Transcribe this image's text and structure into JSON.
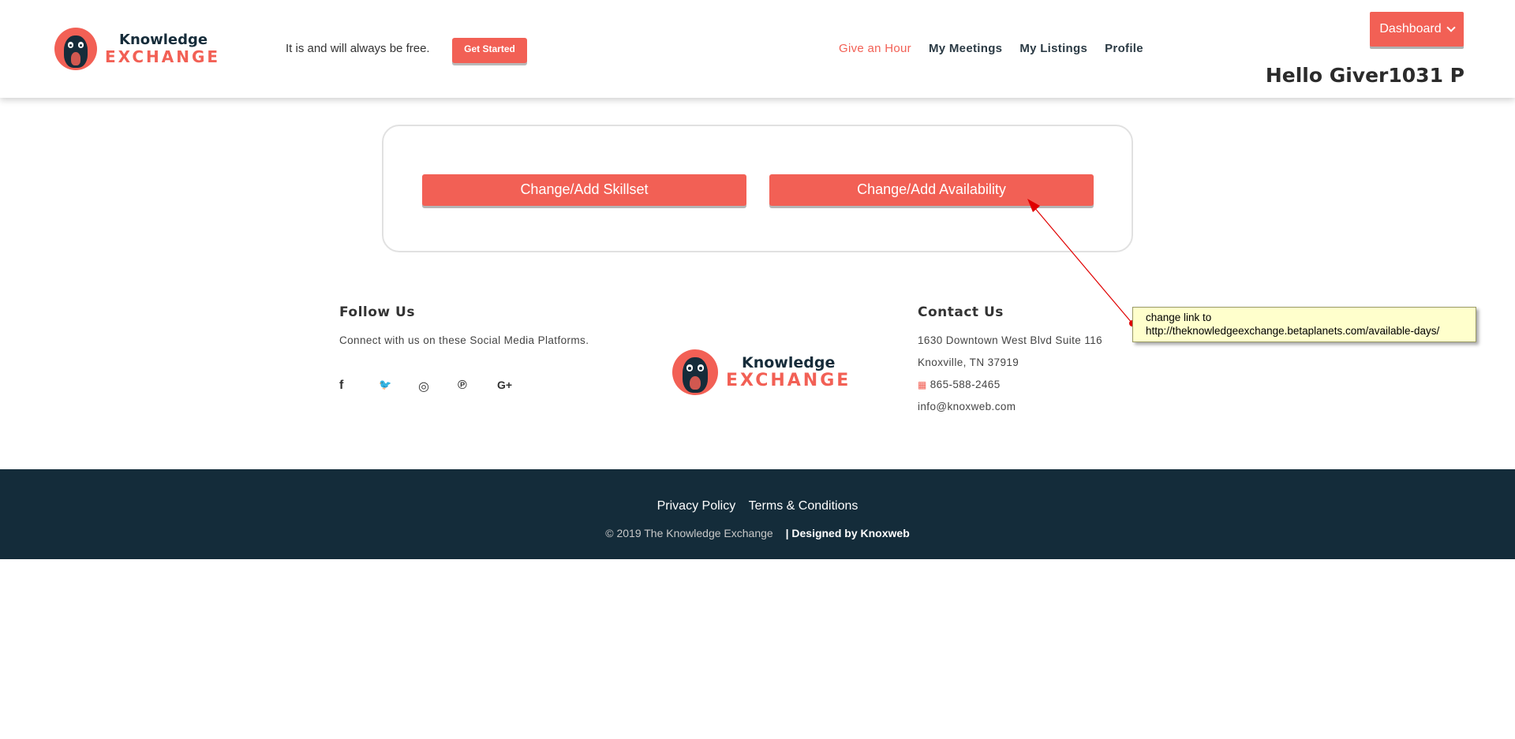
{
  "header": {
    "logo": {
      "line1": "Knowledge",
      "line2": "EXCHANGE"
    },
    "tagline": "It is and will always be free.",
    "get_started_label": "Get Started",
    "nav": [
      {
        "label": "Give an Hour",
        "active": true
      },
      {
        "label": "My Meetings",
        "active": false
      },
      {
        "label": "My Listings",
        "active": false
      },
      {
        "label": "Profile",
        "active": false
      }
    ],
    "dashboard_label": "Dashboard",
    "greeting": "Hello Giver1031 P"
  },
  "actions": {
    "skillset_label": "Change/Add Skillset",
    "availability_label": "Change/Add Availability"
  },
  "annotation": {
    "line1": "change link to",
    "line2": "http://theknowledgeexchange.betaplanets.com/available-days/"
  },
  "footer": {
    "follow": {
      "title": "Follow Us",
      "text": "Connect with us on these Social Media Platforms.",
      "icons": [
        {
          "name": "facebook-icon",
          "glyph": "f"
        },
        {
          "name": "twitter-icon",
          "glyph": "🐦"
        },
        {
          "name": "instagram-icon",
          "glyph": "◎"
        },
        {
          "name": "pinterest-icon",
          "glyph": "℗"
        },
        {
          "name": "google-plus-icon",
          "glyph": "G+"
        }
      ]
    },
    "logo": {
      "line1": "Knowledge",
      "line2": "EXCHANGE"
    },
    "contact": {
      "title": "Contact Us",
      "address1": "1630 Downtown West Blvd Suite 116",
      "address2": "Knoxville, TN 37919",
      "phone": "865-588-2465",
      "email": "info@knoxweb.com"
    }
  },
  "bottom_bar": {
    "privacy": "Privacy Policy",
    "terms": "Terms & Conditions",
    "copyright": "© 2019 The Knowledge Exchange",
    "designed_by": "| Designed by Knoxweb"
  },
  "colors": {
    "accent": "#f26055",
    "dark": "#142c3a"
  }
}
